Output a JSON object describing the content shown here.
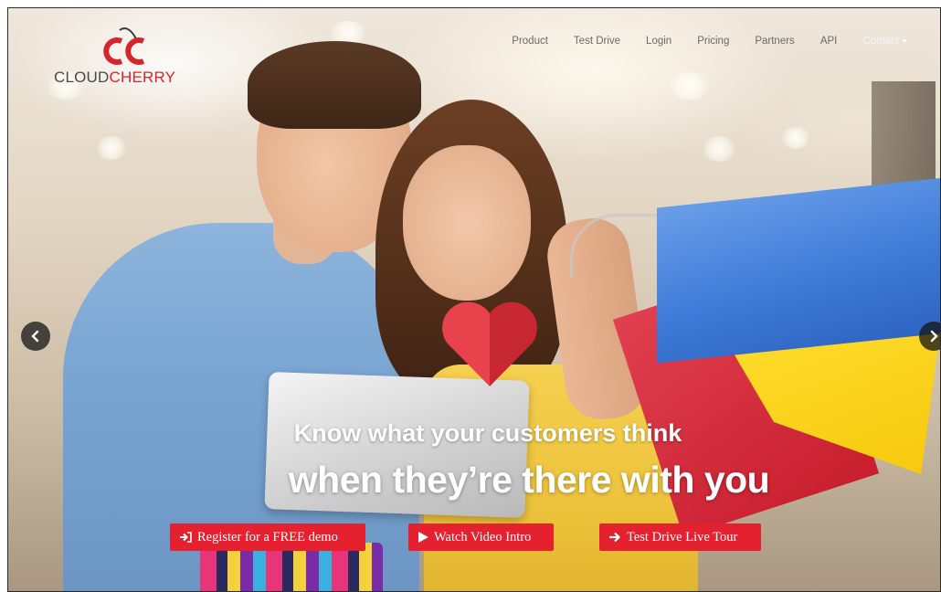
{
  "brand": {
    "logo_mark": "CC",
    "name_part1": "CLOUD",
    "name_part2": "CHERRY",
    "accent_color": "#d6252d"
  },
  "nav": {
    "items": [
      {
        "label": "Product"
      },
      {
        "label": "Test Drive"
      },
      {
        "label": "Login"
      },
      {
        "label": "Pricing"
      },
      {
        "label": "Partners"
      },
      {
        "label": "API"
      },
      {
        "label": "Contact"
      }
    ]
  },
  "carousel": {
    "prev_icon": "chevron-left-icon",
    "next_icon": "chevron-right-icon"
  },
  "hero": {
    "heart_icon": "heart-icon",
    "headline_line1": "Know what your customers think",
    "headline_line2": "when they’re there with you"
  },
  "cta": {
    "register_label": "Register for a FREE demo",
    "register_icon": "sign-in-icon",
    "video_label": "Watch Video Intro",
    "video_icon": "play-icon",
    "tour_label": "Test Drive Live Tour",
    "tour_icon": "arrow-right-icon",
    "button_color": "#e5212f"
  }
}
